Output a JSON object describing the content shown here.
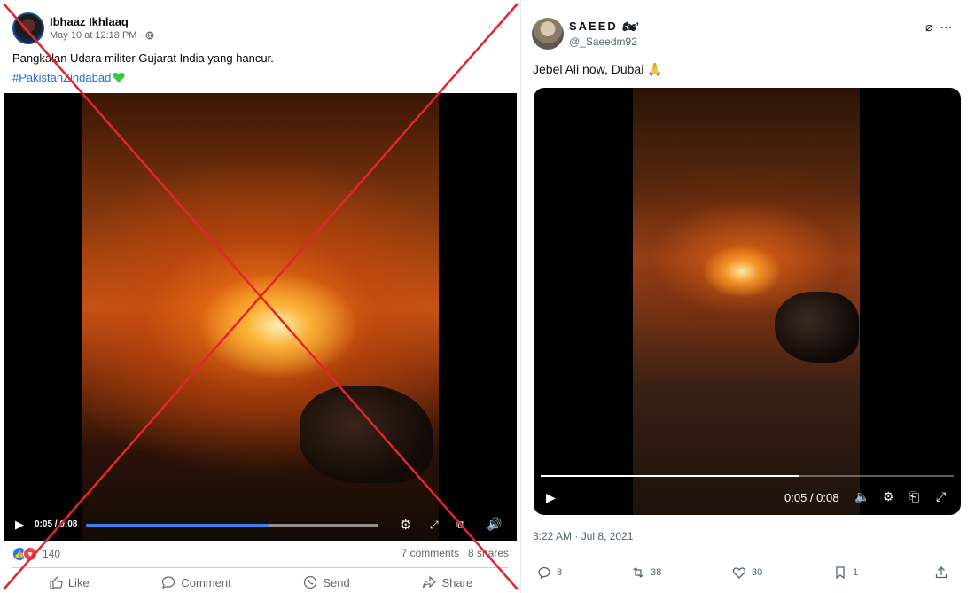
{
  "facebook_post": {
    "author": "Ibhaaz Ikhlaaq",
    "timestamp": "May 10 at 12:18 PM ·",
    "caption": "Pangkalan Udara militer Gujarat India yang hancur.",
    "hashtag": "#PakistanZindabad",
    "video": {
      "time": "0:05 / 0:08",
      "progress": 0.625
    },
    "reactions_count": "140",
    "comments": "7 comments",
    "shares": "8 shares",
    "actions": {
      "like": "Like",
      "comment": "Comment",
      "send": "Send",
      "share": "Share"
    }
  },
  "x_post": {
    "display_name": "SAEED",
    "handle": "@_Saeedm92",
    "text": "Jebel Ali now, Dubai",
    "video": {
      "time": "0:05 / 0:08",
      "progress": 0.625
    },
    "posted_at": "3:22 AM · Jul 8, 2021",
    "replies": "8",
    "reposts": "38",
    "likes": "30",
    "bookmarks": "1"
  },
  "colors": {
    "facebook_link": "#216fdb",
    "facebook_progress": "#3b82f6",
    "cross_mark": "#e3262b"
  }
}
